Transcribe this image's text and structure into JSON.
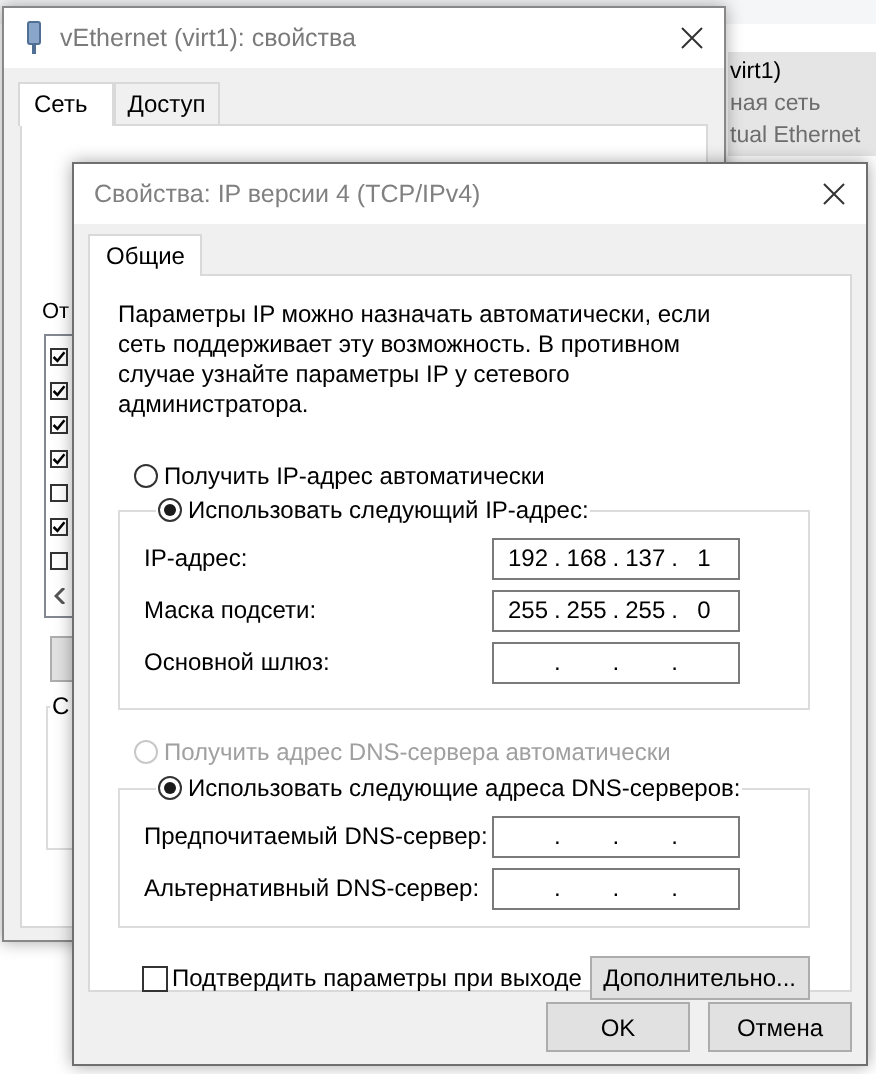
{
  "explorer": {
    "connection": {
      "selected": true,
      "lines": [
        "virt1)",
        "ная сеть",
        "tual Ethernet"
      ]
    }
  },
  "back_window": {
    "title": "vEthernet (virt1): свойства",
    "tabs": [
      {
        "label": "Сеть",
        "selected": true
      },
      {
        "label": "Доступ",
        "selected": false
      }
    ],
    "components_label": "От",
    "components": [
      {
        "checked": true
      },
      {
        "checked": true
      },
      {
        "checked": true
      },
      {
        "checked": true
      },
      {
        "checked": false
      },
      {
        "checked": true
      },
      {
        "checked": false
      }
    ],
    "group_label": "С"
  },
  "dialog": {
    "title": "Свойства: IP версии 4 (TCP/IPv4)",
    "tabs": [
      {
        "label": "Общие",
        "selected": true
      }
    ],
    "description": "Параметры IP можно назначать автоматически, если сеть поддерживает эту возможность. В противном случае узнайте параметры IP у сетевого администратора.",
    "ip_separator": ".",
    "ip_auto": {
      "label": "Получить IP-адрес автоматически",
      "selected": false,
      "disabled": false
    },
    "ip_manual": {
      "label": "Использовать следующий IP-адрес:",
      "selected": true,
      "disabled": false,
      "fields": [
        {
          "label": "IP-адрес:",
          "octets": [
            "192",
            "168",
            "137",
            "1"
          ]
        },
        {
          "label": "Маска подсети:",
          "octets": [
            "255",
            "255",
            "255",
            "0"
          ]
        },
        {
          "label": "Основной шлюз:"
        }
      ]
    },
    "dns_auto": {
      "label": "Получить адрес DNS-сервера автоматически",
      "selected": false,
      "disabled": true
    },
    "dns_manual": {
      "label": "Использовать следующие адреса DNS-серверов:",
      "selected": true,
      "disabled": false,
      "fields": [
        {
          "label": "Предпочитаемый DNS-сервер:"
        },
        {
          "label": "Альтернативный DNS-сервер:"
        }
      ]
    },
    "validate": {
      "label": "Подтвердить параметры при выходе",
      "checked": false
    },
    "advanced_button": "Дополнительно...",
    "buttons": [
      "OK",
      "Отмена"
    ]
  }
}
